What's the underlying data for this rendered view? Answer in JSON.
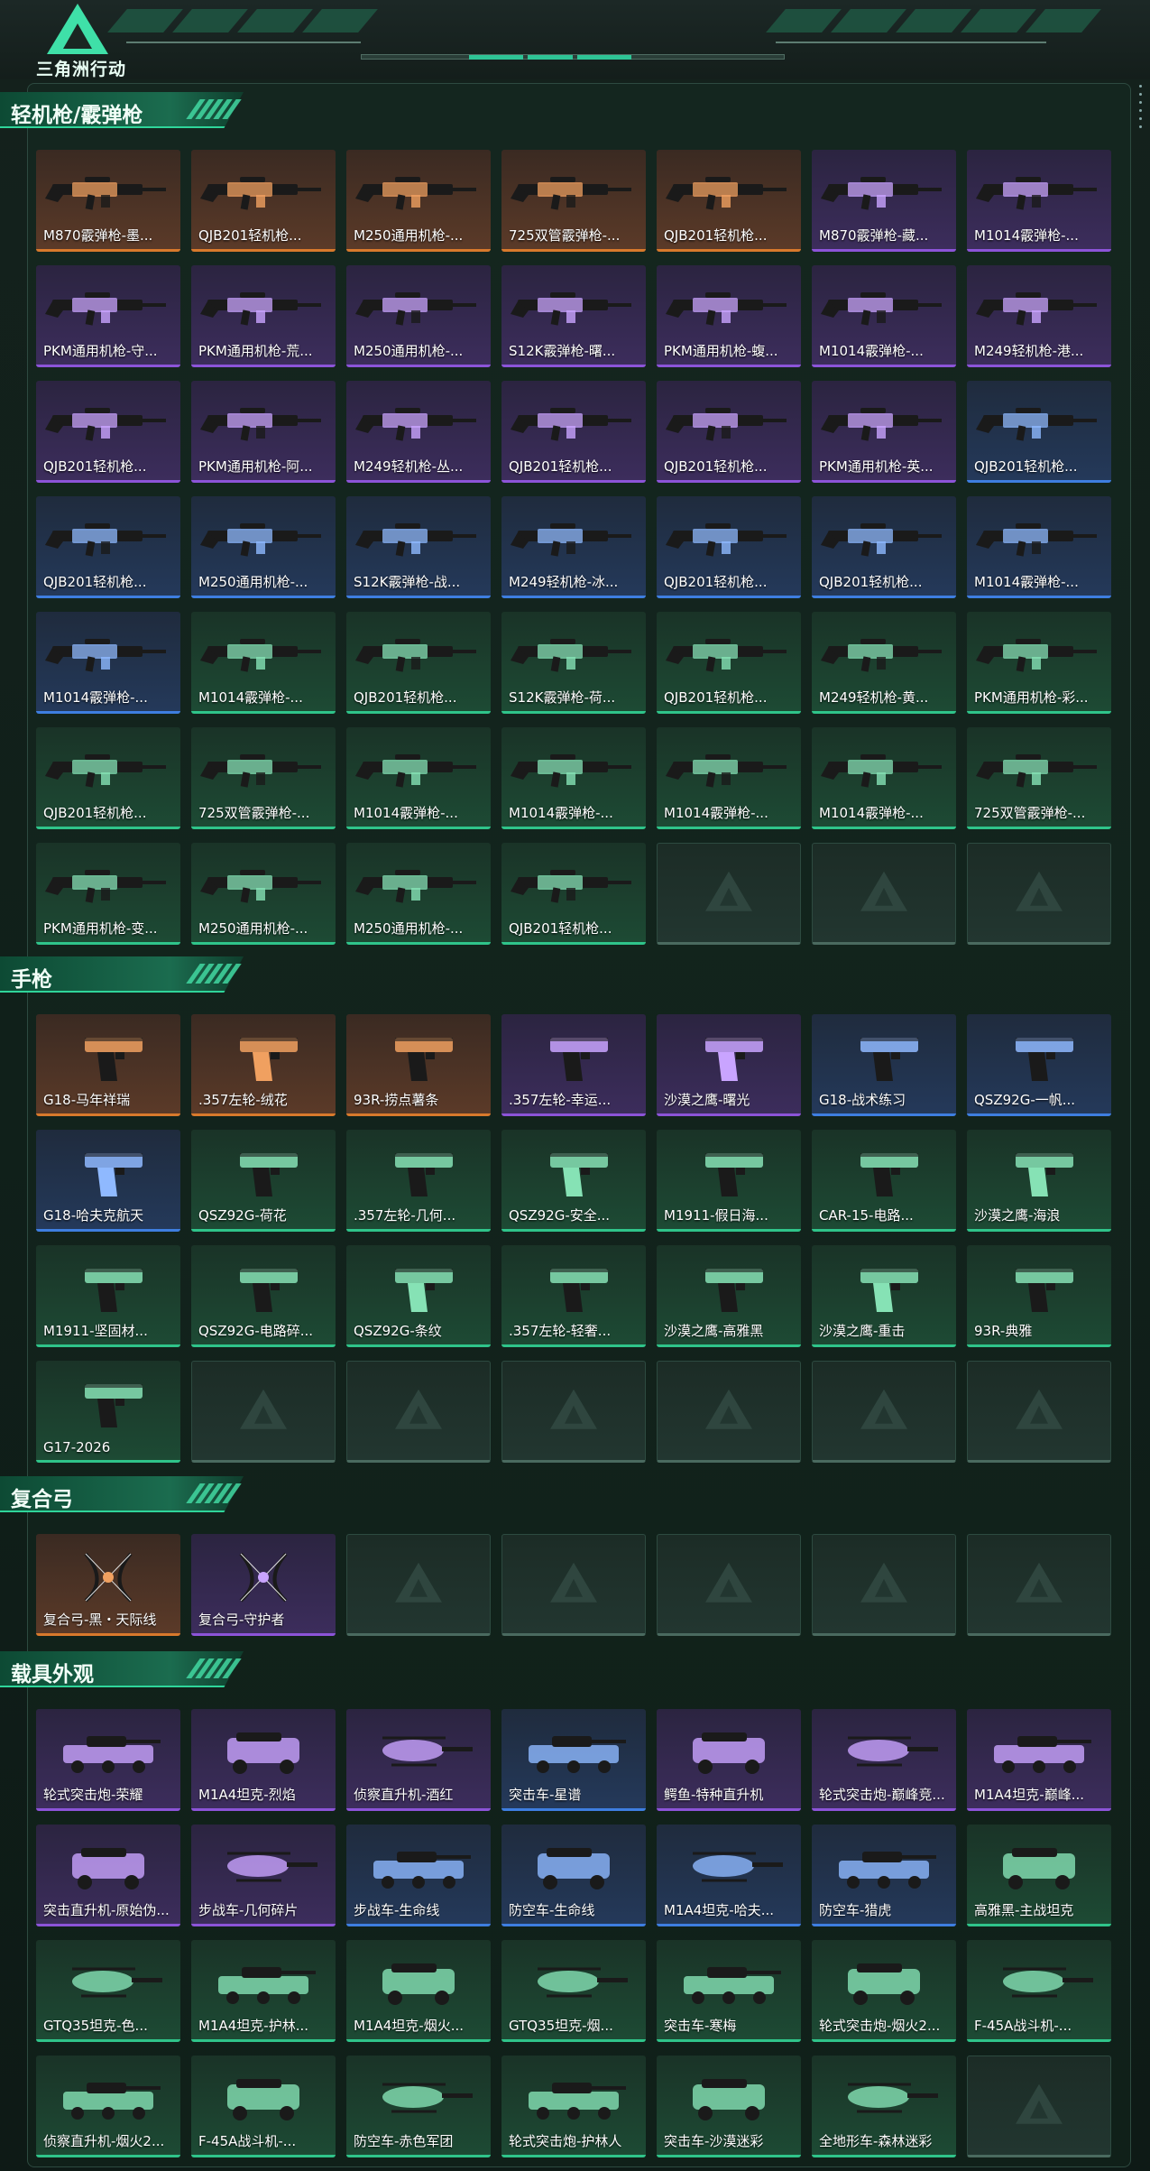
{
  "header": {
    "title": "三角洲行动"
  },
  "colors": {
    "orange": "#d8792c",
    "purple": "#8c54d8",
    "blue": "#3e7ee0",
    "green": "#2fc48a",
    "accent": "#2ec495"
  },
  "sections": [
    {
      "title": "轻机枪/霰弹枪",
      "icon": "gun",
      "items": [
        {
          "name": "M870霰弹枪-墨...",
          "rarity": "orange"
        },
        {
          "name": "QJB201轻机枪...",
          "rarity": "orange"
        },
        {
          "name": "M250通用机枪-...",
          "rarity": "orange"
        },
        {
          "name": "725双管霰弹枪-...",
          "rarity": "orange"
        },
        {
          "name": "QJB201轻机枪...",
          "rarity": "orange"
        },
        {
          "name": "M870霰弹枪-藏...",
          "rarity": "purple"
        },
        {
          "name": "M1014霰弹枪-...",
          "rarity": "purple"
        },
        {
          "name": "PKM通用机枪-守...",
          "rarity": "purple"
        },
        {
          "name": "PKM通用机枪-荒...",
          "rarity": "purple"
        },
        {
          "name": "M250通用机枪-...",
          "rarity": "purple"
        },
        {
          "name": "S12K霰弹枪-曙...",
          "rarity": "purple"
        },
        {
          "name": "PKM通用机枪-蝮...",
          "rarity": "purple"
        },
        {
          "name": "M1014霰弹枪-...",
          "rarity": "purple"
        },
        {
          "name": "M249轻机枪-港...",
          "rarity": "purple"
        },
        {
          "name": "QJB201轻机枪...",
          "rarity": "purple"
        },
        {
          "name": "PKM通用机枪-阿...",
          "rarity": "purple"
        },
        {
          "name": "M249轻机枪-丛...",
          "rarity": "purple"
        },
        {
          "name": "QJB201轻机枪...",
          "rarity": "purple"
        },
        {
          "name": "QJB201轻机枪...",
          "rarity": "purple"
        },
        {
          "name": "PKM通用机枪-英...",
          "rarity": "purple"
        },
        {
          "name": "QJB201轻机枪...",
          "rarity": "blue"
        },
        {
          "name": "QJB201轻机枪...",
          "rarity": "blue"
        },
        {
          "name": "M250通用机枪-...",
          "rarity": "blue"
        },
        {
          "name": "S12K霰弹枪-战...",
          "rarity": "blue"
        },
        {
          "name": "M249轻机枪-冰...",
          "rarity": "blue"
        },
        {
          "name": "QJB201轻机枪...",
          "rarity": "blue"
        },
        {
          "name": "QJB201轻机枪...",
          "rarity": "blue"
        },
        {
          "name": "M1014霰弹枪-...",
          "rarity": "blue"
        },
        {
          "name": "M1014霰弹枪-...",
          "rarity": "blue"
        },
        {
          "name": "M1014霰弹枪-...",
          "rarity": "green"
        },
        {
          "name": "QJB201轻机枪...",
          "rarity": "green"
        },
        {
          "name": "S12K霰弹枪-荷...",
          "rarity": "green"
        },
        {
          "name": "QJB201轻机枪...",
          "rarity": "green"
        },
        {
          "name": "M249轻机枪-黄...",
          "rarity": "green"
        },
        {
          "name": "PKM通用机枪-彩...",
          "rarity": "green"
        },
        {
          "name": "QJB201轻机枪...",
          "rarity": "green"
        },
        {
          "name": "725双管霰弹枪-...",
          "rarity": "green"
        },
        {
          "name": "M1014霰弹枪-...",
          "rarity": "green"
        },
        {
          "name": "M1014霰弹枪-...",
          "rarity": "green"
        },
        {
          "name": "M1014霰弹枪-...",
          "rarity": "green"
        },
        {
          "name": "M1014霰弹枪-...",
          "rarity": "green"
        },
        {
          "name": "725双管霰弹枪-...",
          "rarity": "green"
        },
        {
          "name": "PKM通用机枪-变...",
          "rarity": "green"
        },
        {
          "name": "M250通用机枪-...",
          "rarity": "green"
        },
        {
          "name": "M250通用机枪-...",
          "rarity": "green"
        },
        {
          "name": "QJB201轻机枪...",
          "rarity": "green"
        },
        {
          "name": "",
          "rarity": "empty"
        },
        {
          "name": "",
          "rarity": "empty"
        },
        {
          "name": "",
          "rarity": "empty"
        }
      ]
    },
    {
      "title": "手枪",
      "icon": "pistol",
      "items": [
        {
          "name": "G18-马年祥瑞",
          "rarity": "orange"
        },
        {
          "name": ".357左轮-绒花",
          "rarity": "orange"
        },
        {
          "name": "93R-捞点薯条",
          "rarity": "orange"
        },
        {
          "name": ".357左轮-幸运...",
          "rarity": "purple"
        },
        {
          "name": "沙漠之鹰-曙光",
          "rarity": "purple"
        },
        {
          "name": "G18-战术练习",
          "rarity": "blue"
        },
        {
          "name": "QSZ92G-一帆...",
          "rarity": "blue"
        },
        {
          "name": "G18-哈夫克航天",
          "rarity": "blue"
        },
        {
          "name": "QSZ92G-荷花",
          "rarity": "green"
        },
        {
          "name": ".357左轮-几何...",
          "rarity": "green"
        },
        {
          "name": "QSZ92G-安全...",
          "rarity": "green"
        },
        {
          "name": "M1911-假日海...",
          "rarity": "green"
        },
        {
          "name": "CAR-15-电路...",
          "rarity": "green"
        },
        {
          "name": "沙漠之鹰-海浪",
          "rarity": "green"
        },
        {
          "name": "M1911-坚固材...",
          "rarity": "green"
        },
        {
          "name": "QSZ92G-电路碎...",
          "rarity": "green"
        },
        {
          "name": "QSZ92G-条纹",
          "rarity": "green"
        },
        {
          "name": ".357左轮-轻奢...",
          "rarity": "green"
        },
        {
          "name": "沙漠之鹰-高雅黑",
          "rarity": "green"
        },
        {
          "name": "沙漠之鹰-重击",
          "rarity": "green"
        },
        {
          "name": "93R-典雅",
          "rarity": "green"
        },
        {
          "name": "G17-2026",
          "rarity": "green"
        },
        {
          "name": "",
          "rarity": "empty"
        },
        {
          "name": "",
          "rarity": "empty"
        },
        {
          "name": "",
          "rarity": "empty"
        },
        {
          "name": "",
          "rarity": "empty"
        },
        {
          "name": "",
          "rarity": "empty"
        },
        {
          "name": "",
          "rarity": "empty"
        }
      ]
    },
    {
      "title": "复合弓",
      "icon": "bow",
      "items": [
        {
          "name": "复合弓-黑・天际线",
          "rarity": "orange"
        },
        {
          "name": "复合弓-守护者",
          "rarity": "purple"
        },
        {
          "name": "",
          "rarity": "empty"
        },
        {
          "name": "",
          "rarity": "empty"
        },
        {
          "name": "",
          "rarity": "empty"
        },
        {
          "name": "",
          "rarity": "empty"
        },
        {
          "name": "",
          "rarity": "empty"
        }
      ]
    },
    {
      "title": "载具外观",
      "icon": "vehicle",
      "items": [
        {
          "name": "轮式突击炮-荣耀",
          "rarity": "purple"
        },
        {
          "name": "M1A4坦克-烈焰",
          "rarity": "purple"
        },
        {
          "name": "侦察直升机-酒红",
          "rarity": "purple"
        },
        {
          "name": "突击车-星谱",
          "rarity": "blue"
        },
        {
          "name": "鳄鱼-特种直升机",
          "rarity": "purple"
        },
        {
          "name": "轮式突击炮-巅峰竞...",
          "rarity": "purple"
        },
        {
          "name": "M1A4坦克-巅峰...",
          "rarity": "purple"
        },
        {
          "name": "突击直升机-原始伪...",
          "rarity": "purple"
        },
        {
          "name": "步战车-几何碎片",
          "rarity": "purple"
        },
        {
          "name": "步战车-生命线",
          "rarity": "blue"
        },
        {
          "name": "防空车-生命线",
          "rarity": "blue"
        },
        {
          "name": "M1A4坦克-哈夫...",
          "rarity": "blue"
        },
        {
          "name": "防空车-猎虎",
          "rarity": "blue"
        },
        {
          "name": "高雅黑-主战坦克",
          "rarity": "green"
        },
        {
          "name": "GTQ35坦克-色...",
          "rarity": "green"
        },
        {
          "name": "M1A4坦克-护林...",
          "rarity": "green"
        },
        {
          "name": "M1A4坦克-烟火...",
          "rarity": "green"
        },
        {
          "name": "GTQ35坦克-烟...",
          "rarity": "green"
        },
        {
          "name": "突击车-寒梅",
          "rarity": "green"
        },
        {
          "name": "轮式突击炮-烟火2...",
          "rarity": "green"
        },
        {
          "name": "F-45A战斗机-...",
          "rarity": "green"
        },
        {
          "name": "侦察直升机-烟火2...",
          "rarity": "green"
        },
        {
          "name": "F-45A战斗机-...",
          "rarity": "green"
        },
        {
          "name": "防空车-赤色军团",
          "rarity": "green"
        },
        {
          "name": "轮式突击炮-护林人",
          "rarity": "green"
        },
        {
          "name": "突击车-沙漠迷彩",
          "rarity": "green"
        },
        {
          "name": "全地形车-森林迷彩",
          "rarity": "green"
        },
        {
          "name": "",
          "rarity": "empty"
        }
      ]
    }
  ]
}
